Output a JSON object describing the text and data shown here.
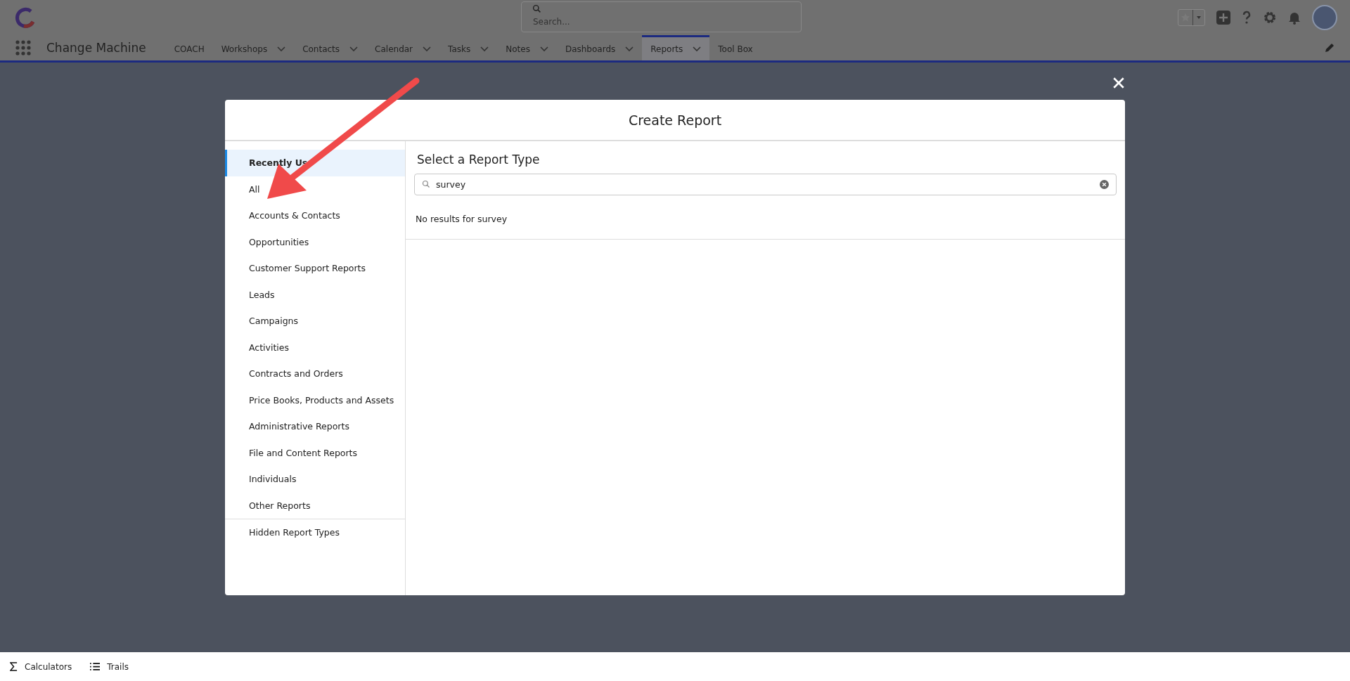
{
  "header": {
    "search": {
      "placeholder": "Search..."
    },
    "app_name": "Change Machine"
  },
  "nav": [
    {
      "label": "COACH",
      "has_menu": false,
      "selected": false
    },
    {
      "label": "Workshops",
      "has_menu": true,
      "selected": false
    },
    {
      "label": "Contacts",
      "has_menu": true,
      "selected": false
    },
    {
      "label": "Calendar",
      "has_menu": true,
      "selected": false
    },
    {
      "label": "Tasks",
      "has_menu": true,
      "selected": false
    },
    {
      "label": "Notes",
      "has_menu": true,
      "selected": false
    },
    {
      "label": "Dashboards",
      "has_menu": true,
      "selected": false
    },
    {
      "label": "Reports",
      "has_menu": true,
      "selected": true
    },
    {
      "label": "Tool Box",
      "has_menu": false,
      "selected": false
    }
  ],
  "modal": {
    "title": "Create Report",
    "sidebar": {
      "items": [
        {
          "label": "Recently Us",
          "selected": true
        },
        {
          "label": "All",
          "selected": false
        },
        {
          "label": "Accounts & Contacts",
          "selected": false
        },
        {
          "label": "Opportunities",
          "selected": false
        },
        {
          "label": "Customer Support Reports",
          "selected": false
        },
        {
          "label": "Leads",
          "selected": false
        },
        {
          "label": "Campaigns",
          "selected": false
        },
        {
          "label": "Activities",
          "selected": false
        },
        {
          "label": "Contracts and Orders",
          "selected": false
        },
        {
          "label": "Price Books, Products and Assets",
          "selected": false
        },
        {
          "label": "Administrative Reports",
          "selected": false
        },
        {
          "label": "File and Content Reports",
          "selected": false
        },
        {
          "label": "Individuals",
          "selected": false
        },
        {
          "label": "Other Reports",
          "selected": false
        }
      ],
      "footer_item": {
        "label": "Hidden Report Types",
        "selected": false
      }
    },
    "heading": "Select a Report Type",
    "search": {
      "value": "survey"
    },
    "message": "No results for survey"
  },
  "footer": [
    {
      "label": "Calculators",
      "kind": "sigma"
    },
    {
      "label": "Trails",
      "kind": "list"
    }
  ]
}
